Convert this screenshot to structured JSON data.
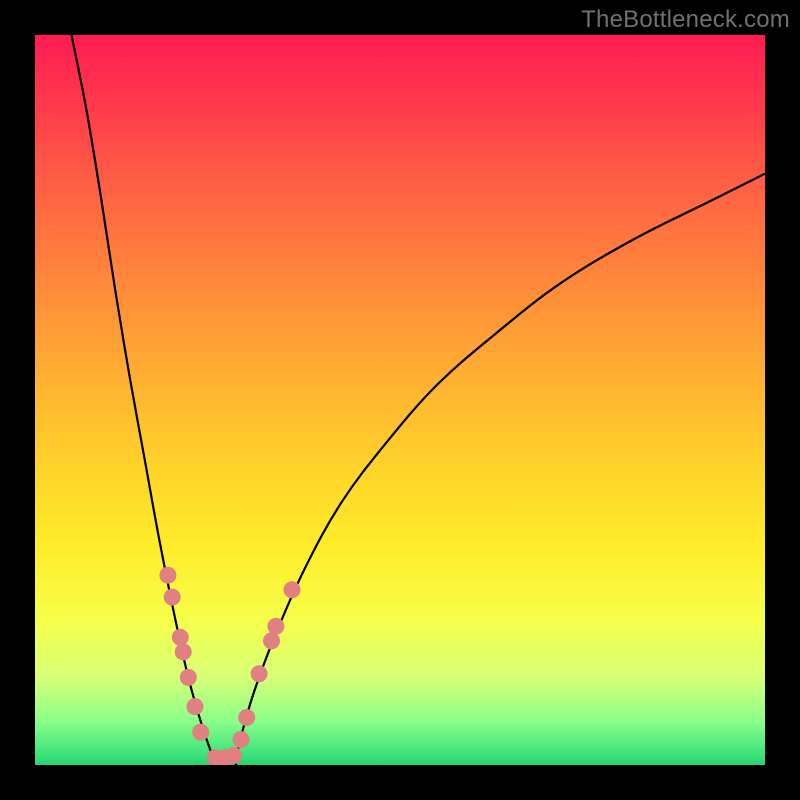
{
  "brand": "TheBottleneck.com",
  "chart_data": {
    "type": "line",
    "title": "",
    "xlabel": "",
    "ylabel": "",
    "xlim": [
      0,
      100
    ],
    "ylim": [
      0,
      100
    ],
    "legend": false,
    "series": [
      {
        "name": "left-curve",
        "x": [
          5,
          7,
          9,
          11,
          13,
          15,
          17,
          19,
          21,
          23,
          24.8
        ],
        "values": [
          100,
          90,
          78,
          65,
          53,
          42,
          31,
          21,
          12,
          5,
          0
        ]
      },
      {
        "name": "right-curve",
        "x": [
          27.5,
          28,
          30,
          33,
          37,
          42,
          48,
          55,
          63,
          72,
          82,
          92,
          100
        ],
        "values": [
          0,
          3,
          10,
          18,
          27,
          36,
          44,
          52,
          59,
          66,
          72,
          77,
          81
        ]
      }
    ],
    "markers": {
      "name": "highlighted-points",
      "points": [
        {
          "x": 18.2,
          "y": 26.0
        },
        {
          "x": 18.8,
          "y": 23.0
        },
        {
          "x": 19.9,
          "y": 17.5
        },
        {
          "x": 20.3,
          "y": 15.5
        },
        {
          "x": 21.0,
          "y": 12.0
        },
        {
          "x": 21.9,
          "y": 8.0
        },
        {
          "x": 22.7,
          "y": 4.5
        },
        {
          "x": 24.7,
          "y": 1.0
        },
        {
          "x": 26.0,
          "y": 1.0
        },
        {
          "x": 27.2,
          "y": 1.3
        },
        {
          "x": 28.2,
          "y": 3.5
        },
        {
          "x": 29.0,
          "y": 6.5
        },
        {
          "x": 30.7,
          "y": 12.5
        },
        {
          "x": 32.4,
          "y": 17.0
        },
        {
          "x": 33.0,
          "y": 19.0
        },
        {
          "x": 35.2,
          "y": 24.0
        }
      ]
    },
    "background_gradient": {
      "top": "#ff1b54",
      "bottom": "#2ad070"
    }
  }
}
